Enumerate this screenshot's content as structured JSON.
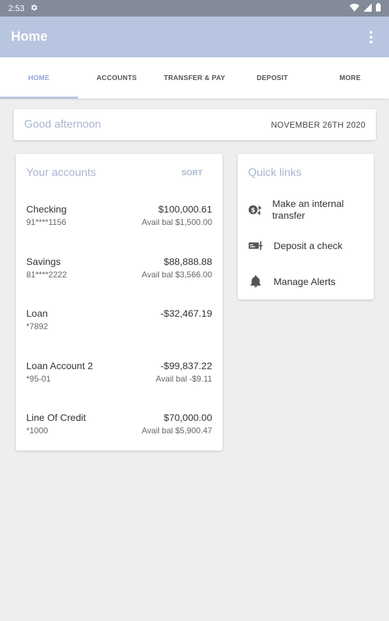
{
  "status_bar": {
    "time": "2:53"
  },
  "app_bar": {
    "title": "Home"
  },
  "tabs": [
    {
      "label": "HOME"
    },
    {
      "label": "ACCOUNTS"
    },
    {
      "label": "TRANSFER & PAY"
    },
    {
      "label": "DEPOSIT"
    },
    {
      "label": "MORE"
    }
  ],
  "greeting": {
    "text": "Good afternoon",
    "date": "NOVEMBER 26TH 2020"
  },
  "accounts": {
    "title": "Your accounts",
    "sort_label": "SORT",
    "items": [
      {
        "name": "Checking",
        "number": "91****1156",
        "amount": "$100,000.61",
        "avail": "Avail bal $1,500.00"
      },
      {
        "name": "Savings",
        "number": "81****2222",
        "amount": "$88,888.88",
        "avail": "Avail bal $3,566.00"
      },
      {
        "name": "Loan",
        "number": "*7892",
        "amount": "-$32,467.19",
        "avail": ""
      },
      {
        "name": "Loan Account 2",
        "number": "*95-01",
        "amount": "-$99,837.22",
        "avail": "Avail bal -$9.11"
      },
      {
        "name": "Line Of Credit",
        "number": "*1000",
        "amount": "$70,000.00",
        "avail": "Avail bal $5,900.47"
      }
    ]
  },
  "quick_links": {
    "title": "Quick links",
    "items": [
      {
        "label": "Make an internal transfer",
        "icon": "transfer-icon"
      },
      {
        "label": "Deposit a check",
        "icon": "check-deposit-icon"
      },
      {
        "label": "Manage Alerts",
        "icon": "bell-icon"
      }
    ]
  },
  "colors": {
    "app_bar": "#b8c5e0",
    "accent": "#8fa6d9",
    "status_bar": "#838a99",
    "background": "#eeeeee"
  }
}
